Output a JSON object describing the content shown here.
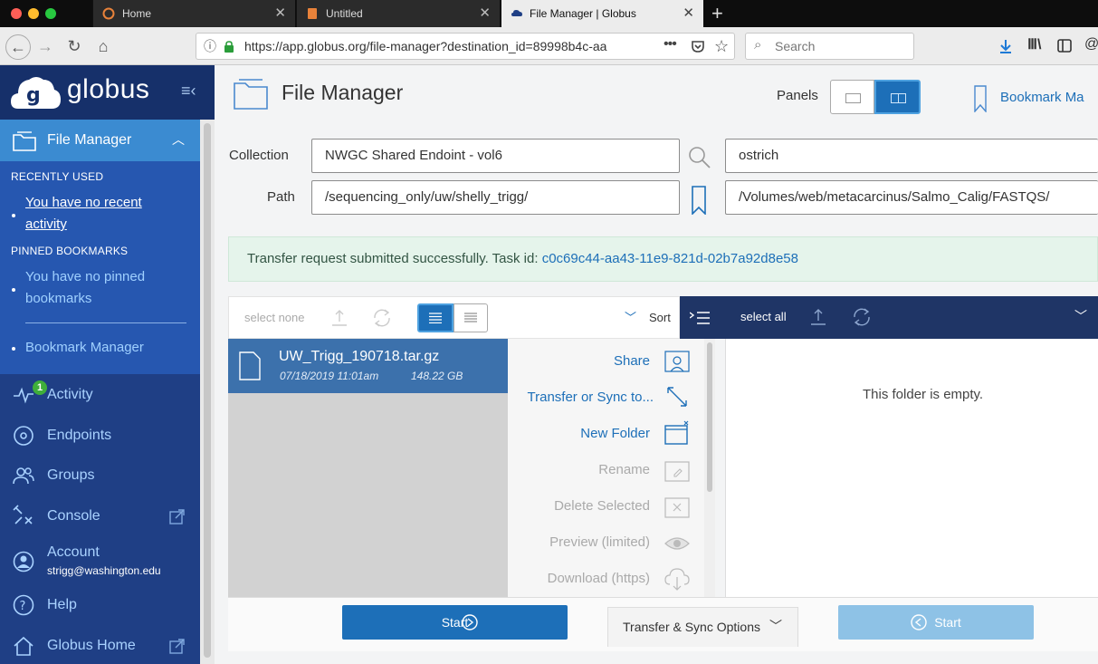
{
  "browser": {
    "tabs": [
      {
        "title": "Home"
      },
      {
        "title": "Untitled"
      },
      {
        "title": "File Manager | Globus"
      }
    ],
    "url": "https://app.globus.org/file-manager?destination_id=89998b4c-aa",
    "search_placeholder": "Search"
  },
  "sidebar": {
    "logo_text": "globus",
    "file_manager_label": "File Manager",
    "recently_used_heading": "RECENTLY USED",
    "recent_empty": "You have no recent activity",
    "pinned_heading": "PINNED BOOKMARKS",
    "pinned_empty": "You have no pinned bookmarks",
    "bookmark_manager": "Bookmark Manager",
    "items": [
      {
        "label": "Activity",
        "icon": "activity-icon",
        "badge": "1"
      },
      {
        "label": "Endpoints",
        "icon": "endpoints-icon"
      },
      {
        "label": "Groups",
        "icon": "groups-icon"
      },
      {
        "label": "Console",
        "icon": "console-icon"
      },
      {
        "label": "Account",
        "icon": "account-icon",
        "sub": "strigg@washington.edu"
      },
      {
        "label": "Help",
        "icon": "help-icon"
      },
      {
        "label": "Globus Home",
        "icon": "home-icon"
      }
    ]
  },
  "header": {
    "title": "File Manager",
    "panels_label": "Panels",
    "bookmark_label": "Bookmark Ma"
  },
  "left": {
    "collection_label": "Collection",
    "collection_value": "NWGC Shared Endoint - vol6",
    "path_label": "Path",
    "path_value": "/sequencing_only/uw/shelly_trigg/"
  },
  "right": {
    "collection_value": "ostrich",
    "path_value": "/Volumes/web/metacarcinus/Salmo_Calig/FASTQS/"
  },
  "notice": {
    "text": "Transfer request submitted successfully. Task id: ",
    "task_id": "c0c69c44-aa43-11e9-821d-02b7a92d8e58"
  },
  "left_toolbar": {
    "select_none": "select none",
    "sort": "Sort"
  },
  "right_toolbar": {
    "select_all": "select all"
  },
  "file": {
    "name": "UW_Trigg_190718.tar.gz",
    "date": "07/18/2019 11:01am",
    "size": "148.22 GB"
  },
  "menu": {
    "items": [
      {
        "label": "Share",
        "icon": "share-icon",
        "enabled": true
      },
      {
        "label": "Transfer or Sync to...",
        "icon": "transfer-icon",
        "enabled": true
      },
      {
        "label": "New Folder",
        "icon": "new-folder-icon",
        "enabled": true
      },
      {
        "label": "Rename",
        "icon": "rename-icon",
        "enabled": false
      },
      {
        "label": "Delete Selected",
        "icon": "delete-icon",
        "enabled": false
      },
      {
        "label": "Preview (limited)",
        "icon": "eye-icon",
        "enabled": false
      },
      {
        "label": "Download (https)",
        "icon": "download-cloud-icon",
        "enabled": false
      }
    ]
  },
  "right_pane": {
    "empty": "This folder is empty."
  },
  "bottom": {
    "start_left": "Start",
    "options": "Transfer & Sync Options",
    "start_right": "Start"
  },
  "colors": {
    "sidebar": "#1f3f85",
    "accent": "#3b8bd1",
    "primary_button": "#1d6fb8",
    "disabled_button": "#8ec2e6"
  }
}
